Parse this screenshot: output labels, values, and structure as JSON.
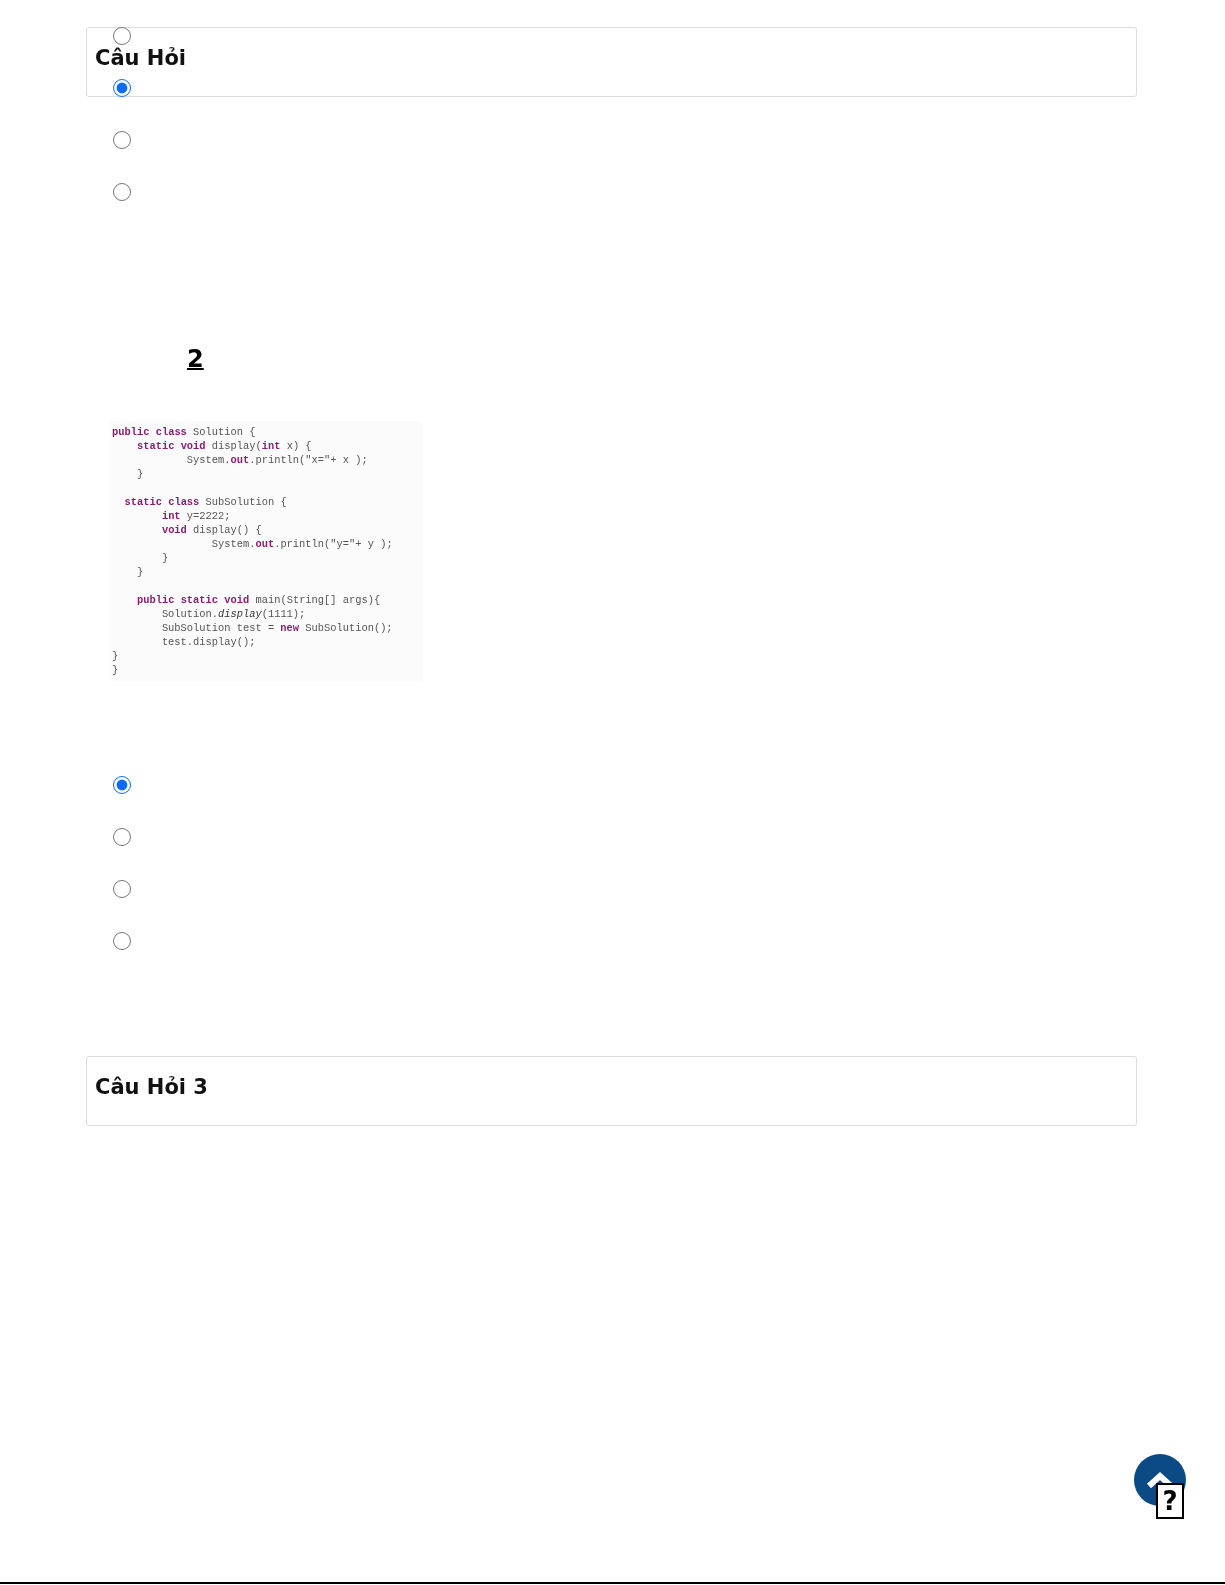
{
  "question_1": {
    "header": {
      "title": "Câu Hỏi"
    },
    "options": [
      {
        "selected": false
      },
      {
        "selected": true
      },
      {
        "selected": false
      },
      {
        "selected": false
      }
    ]
  },
  "question_2": {
    "number": "2",
    "code_blocks": [
      [
        "**public** **class** Solution {",
        "    **static** **void** display(**int** x) {",
        "            System.**out**.println(\"x=\"+ x );",
        "    }"
      ],
      [
        "  **static** **class** SubSolution {",
        "        **int** y=2222;",
        "        **void** display() {",
        "                System.**out**.println(\"y=\"+ y );",
        "        }",
        "    }"
      ],
      [
        "    **public** **static** **void** main(String[] args){",
        "        Solution.*display*(1111);",
        "        SubSolution test = **new** SubSolution();",
        "        test.display();",
        "}",
        "}"
      ]
    ],
    "options": [
      {
        "selected": true
      },
      {
        "selected": false
      },
      {
        "selected": false
      },
      {
        "selected": false
      }
    ]
  },
  "question_3": {
    "header": {
      "title": "Câu Hỏi 3"
    }
  },
  "scroll_top_button": {
    "glyph": "?"
  }
}
